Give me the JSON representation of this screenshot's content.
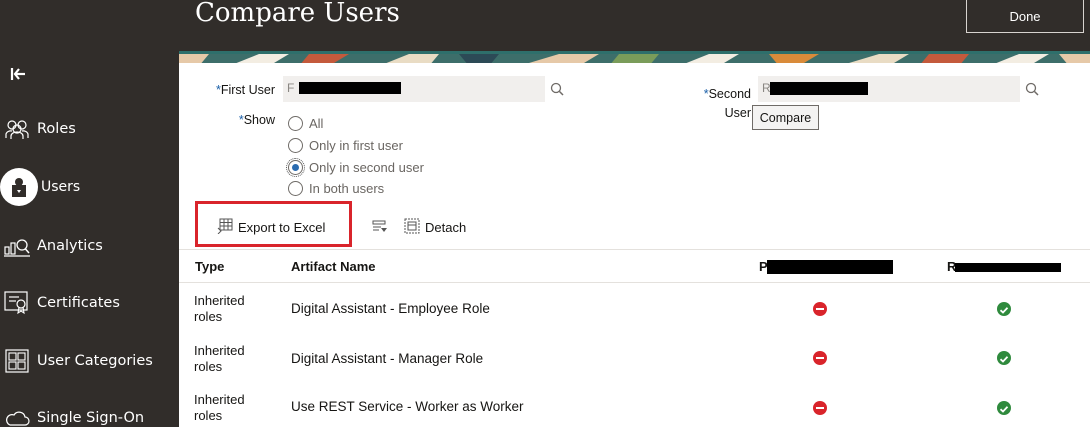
{
  "page": {
    "title": "Compare Users",
    "done_label": "Done",
    "colors": {
      "sidebar_bg": "#312d2a",
      "accent_red": "#d9242b",
      "ok_green": "#2f8a3d",
      "deny_red": "#d9242b"
    }
  },
  "sidebar": {
    "collapse_icon": "collapse-left-icon",
    "items": [
      {
        "label": "Roles",
        "icon": "roles-icon",
        "active": false
      },
      {
        "label": "Users",
        "icon": "user-icon",
        "active": true
      },
      {
        "label": "Analytics",
        "icon": "analytics-icon",
        "active": false
      },
      {
        "label": "Certificates",
        "icon": "certificate-icon",
        "active": false
      },
      {
        "label": "User Categories",
        "icon": "user-categories-icon",
        "active": false
      },
      {
        "label": "Single Sign-On",
        "icon": "cloud-icon",
        "active": false
      }
    ]
  },
  "form": {
    "first_user_label": "First User",
    "first_user_value": "F",
    "second_user_label_1": "Second",
    "second_user_label_2": "User",
    "second_user_value": "R",
    "required_mark": "*",
    "compare_label": "Compare",
    "show_label": "Show",
    "show_options": [
      {
        "label": "All",
        "checked": false
      },
      {
        "label": "Only in first user",
        "checked": false
      },
      {
        "label": "Only in second user",
        "checked": true
      },
      {
        "label": "In both users",
        "checked": false
      }
    ]
  },
  "toolbar": {
    "export_label": "Export to Excel",
    "detach_label": "Detach"
  },
  "table": {
    "columns": {
      "type": "Type",
      "artifact": "Artifact Name",
      "first_user": "P",
      "second_user": "R"
    },
    "rows": [
      {
        "type_line1": "Inherited",
        "type_line2": "roles",
        "artifact": "Digital Assistant - Employee Role",
        "first_user_status": "deny",
        "second_user_status": "ok"
      },
      {
        "type_line1": "Inherited",
        "type_line2": "roles",
        "artifact": "Digital Assistant - Manager Role",
        "first_user_status": "deny",
        "second_user_status": "ok"
      },
      {
        "type_line1": "Inherited",
        "type_line2": "roles",
        "artifact": "Use REST Service - Worker as Worker",
        "first_user_status": "deny",
        "second_user_status": "ok"
      }
    ]
  }
}
